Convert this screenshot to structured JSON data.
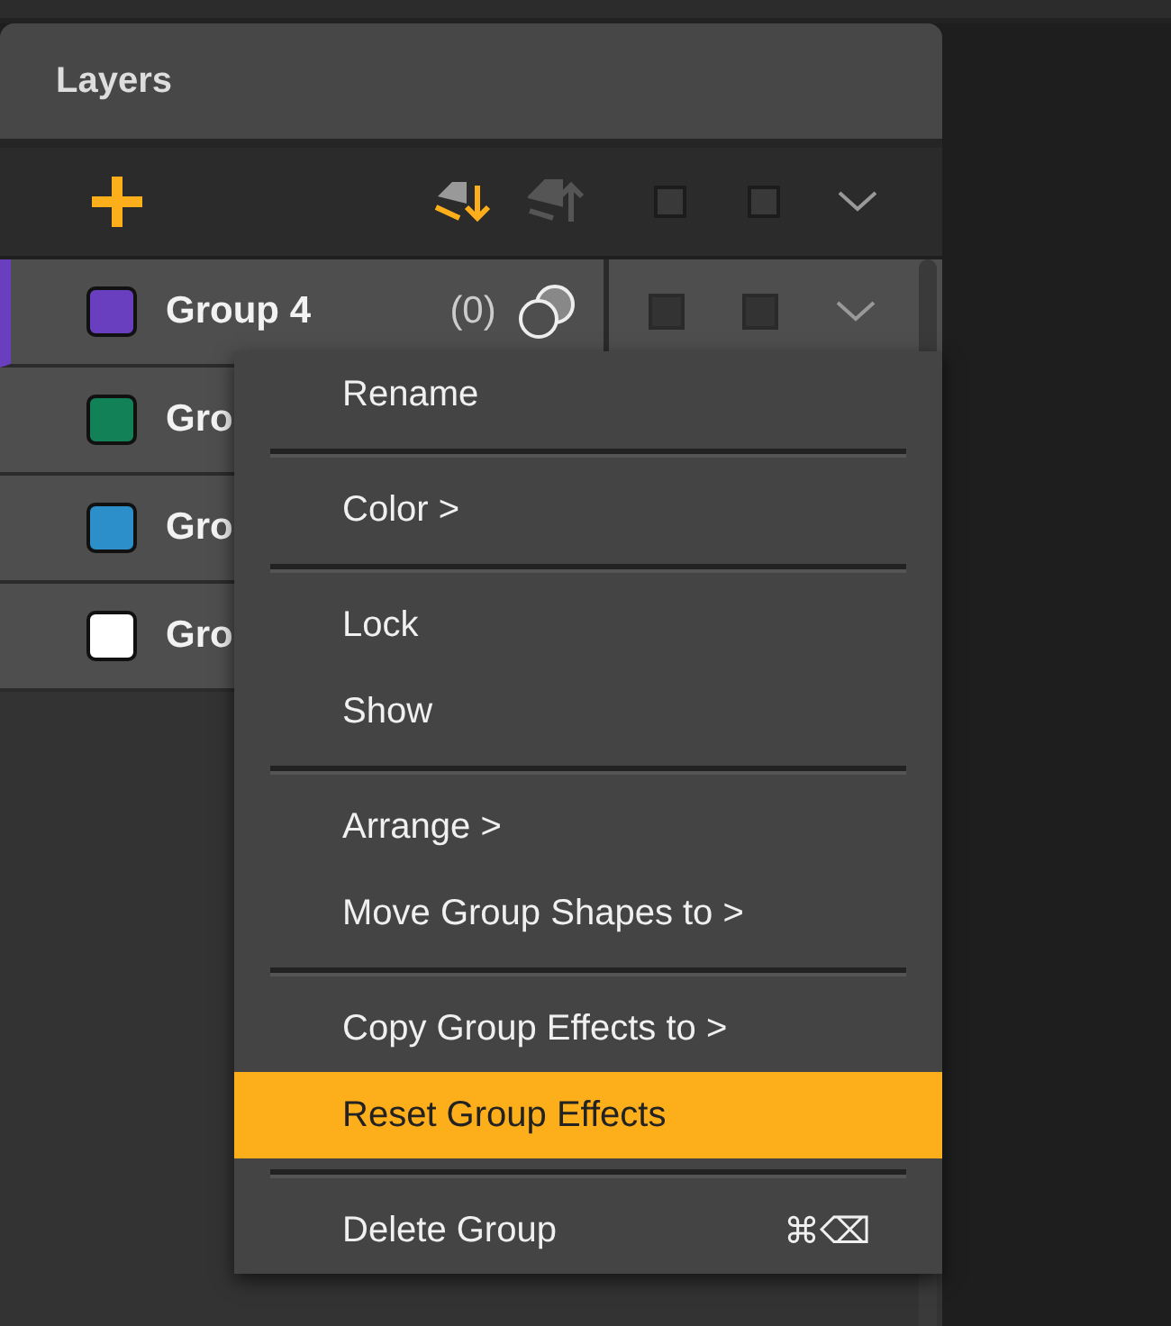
{
  "panel": {
    "title": "Layers"
  },
  "rows": [
    {
      "name": "Group 4",
      "color": "#6a3fbf",
      "selected": true,
      "count": "(0)"
    },
    {
      "name": "Gro",
      "color": "#138158",
      "selected": false
    },
    {
      "name": "Gro",
      "color": "#2c8fc9",
      "selected": false
    },
    {
      "name": "Gro",
      "color": "#ffffff",
      "selected": false
    }
  ],
  "context_menu": [
    {
      "kind": "item",
      "label": "Rename",
      "selected": false
    },
    {
      "kind": "separator"
    },
    {
      "kind": "item",
      "label": "Color >",
      "selected": false
    },
    {
      "kind": "separator"
    },
    {
      "kind": "item",
      "label": "Lock",
      "selected": false
    },
    {
      "kind": "item",
      "label": "Show",
      "selected": false
    },
    {
      "kind": "separator"
    },
    {
      "kind": "item",
      "label": "Arrange >",
      "selected": false
    },
    {
      "kind": "item",
      "label": "Move Group Shapes to >",
      "selected": false
    },
    {
      "kind": "separator"
    },
    {
      "kind": "item",
      "label": "Copy Group Effects to >",
      "selected": false
    },
    {
      "kind": "item",
      "label": "Reset Group Effects",
      "selected": true
    },
    {
      "kind": "separator"
    },
    {
      "kind": "item",
      "label": "Delete Group",
      "selected": false,
      "shortcut": "⌘⌫"
    }
  ]
}
